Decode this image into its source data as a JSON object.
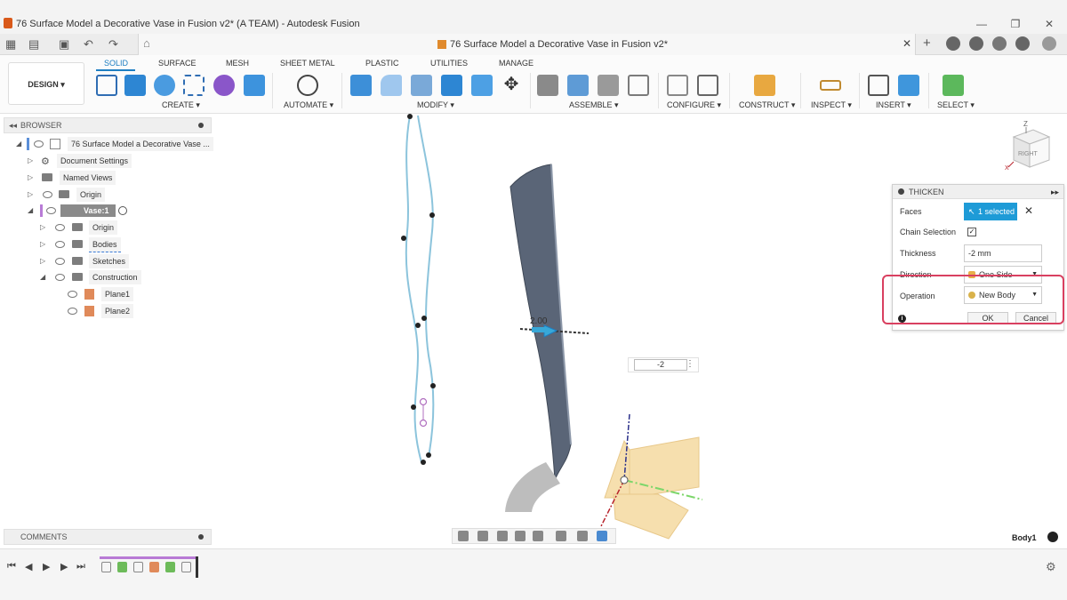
{
  "window": {
    "title": "76 Surface Model a Decorative Vase in Fusion v2* (A TEAM) - Autodesk Fusion"
  },
  "document_tab": {
    "title": "76 Surface Model a Decorative Vase in Fusion v2*"
  },
  "workspace": {
    "label": "DESIGN ▾"
  },
  "tabs": [
    {
      "label": "SOLID",
      "active": true
    },
    {
      "label": "SURFACE"
    },
    {
      "label": "MESH"
    },
    {
      "label": "SHEET METAL"
    },
    {
      "label": "PLASTIC"
    },
    {
      "label": "UTILITIES"
    },
    {
      "label": "MANAGE"
    }
  ],
  "groups": {
    "create": "CREATE ▾",
    "automate": "AUTOMATE ▾",
    "modify": "MODIFY ▾",
    "assemble": "ASSEMBLE ▾",
    "configure": "CONFIGURE ▾",
    "construct": "CONSTRUCT ▾",
    "inspect": "INSPECT ▾",
    "insert": "INSERT ▾",
    "select": "SELECT ▾"
  },
  "browser": {
    "title": "BROWSER",
    "root": "76 Surface Model a Decorative Vase ...",
    "items": [
      {
        "label": "Document Settings"
      },
      {
        "label": "Named Views"
      },
      {
        "label": "Origin"
      },
      {
        "label": "Vase:1"
      },
      {
        "label": "Origin"
      },
      {
        "label": "Bodies"
      },
      {
        "label": "Sketches"
      },
      {
        "label": "Construction"
      },
      {
        "label": "Plane1"
      },
      {
        "label": "Plane2"
      }
    ]
  },
  "comments": {
    "title": "COMMENTS"
  },
  "thicken": {
    "title": "THICKEN",
    "faces_label": "Faces",
    "faces_value": "1 selected",
    "chain_label": "Chain Selection",
    "chain_checked": "✓",
    "thickness_label": "Thickness",
    "thickness_value": "-2 mm",
    "direction_label": "Direction",
    "direction_value": "One Side",
    "operation_label": "Operation",
    "operation_value": "New Body",
    "ok": "OK",
    "cancel": "Cancel"
  },
  "canvas": {
    "dimension_label": "2.00",
    "input_value": "-2",
    "viewcube_face": "RIGHT",
    "body_label": "Body1"
  },
  "colors": {
    "accent": "#1d7ec2",
    "selection": "#1e9bd7",
    "callout": "#d94060",
    "body": "#5a6577",
    "sketch": "#8cc4dc",
    "plane": "#f6dfae"
  }
}
